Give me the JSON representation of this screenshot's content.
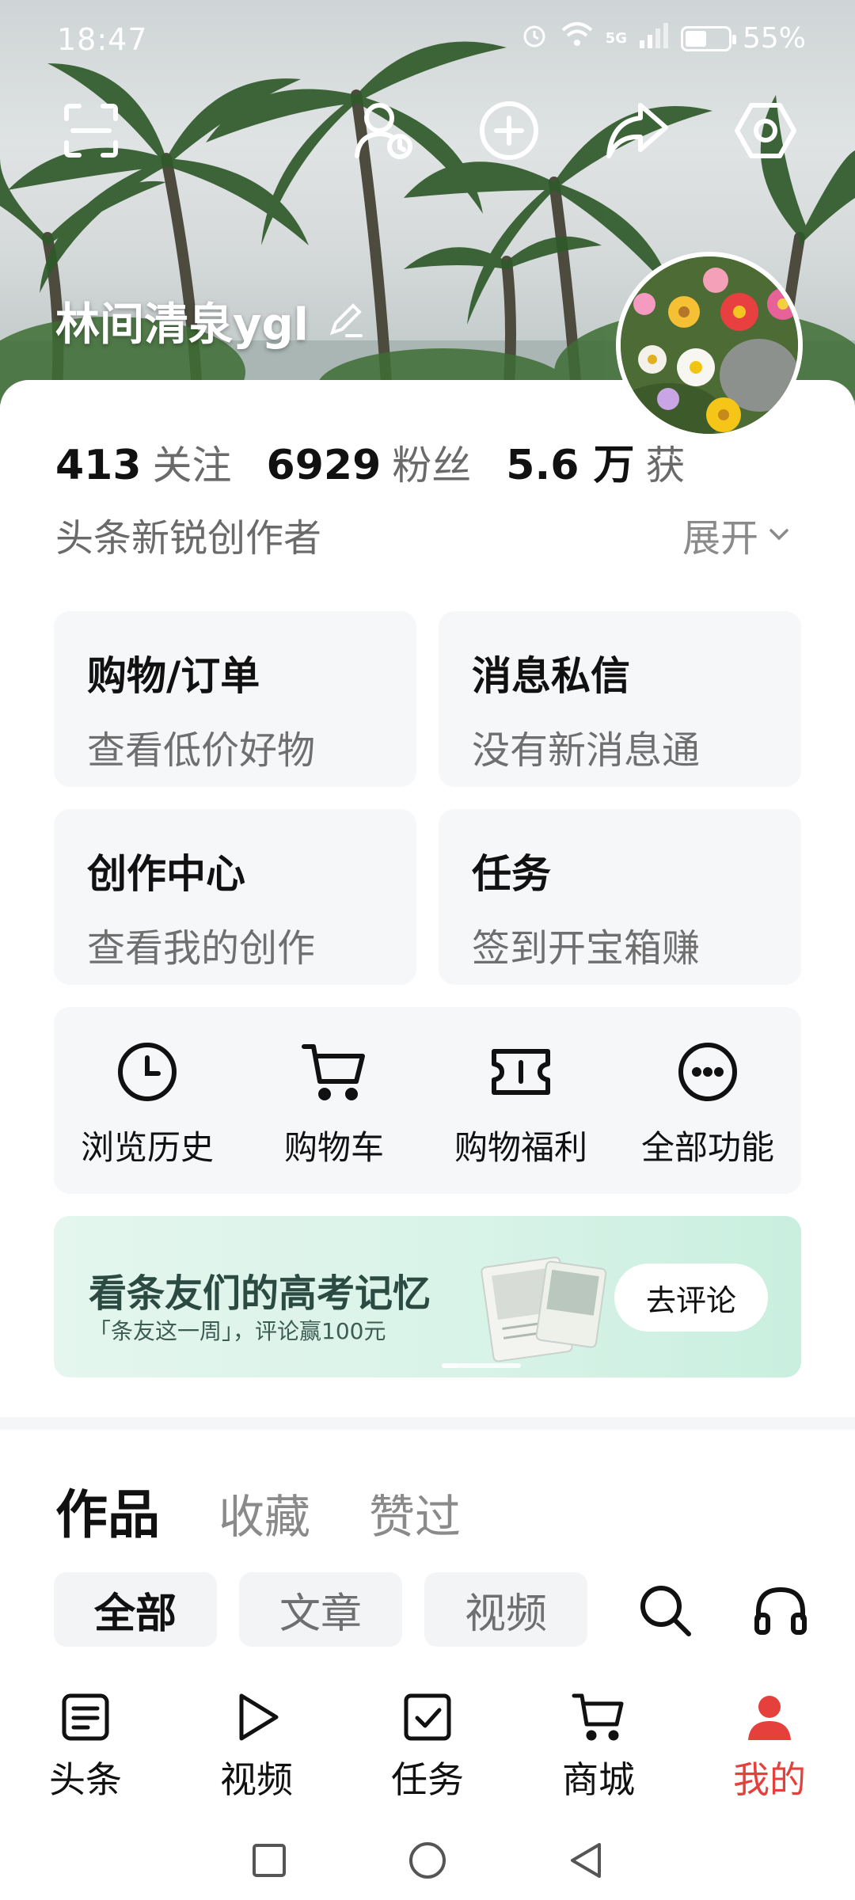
{
  "status_bar": {
    "time": "18:47",
    "network": "5G",
    "battery_percent": "55%",
    "battery_level": 0.55
  },
  "header": {
    "username": "林间清泉ygl",
    "icons": [
      "scan-icon",
      "user-clock-icon",
      "add-circle-icon",
      "share-icon",
      "settings-icon"
    ]
  },
  "stats": [
    {
      "value": "413",
      "label": "关注"
    },
    {
      "value": "6929",
      "label": "粉丝"
    },
    {
      "value": "5.6 万",
      "label": "获"
    }
  ],
  "profile": {
    "creator_tag": "头条新锐创作者",
    "expand_label": "展开"
  },
  "tiles": [
    {
      "title": "购物/订单",
      "subtitle": "查看低价好物"
    },
    {
      "title": "消息私信",
      "subtitle": "没有新消息通"
    },
    {
      "title": "创作中心",
      "subtitle": "查看我的创作"
    },
    {
      "title": "任务",
      "subtitle": "签到开宝箱赚"
    }
  ],
  "shortcuts": [
    {
      "label": "浏览历史",
      "icon": "clock-icon"
    },
    {
      "label": "购物车",
      "icon": "cart-icon"
    },
    {
      "label": "购物福利",
      "icon": "ticket-icon"
    },
    {
      "label": "全部功能",
      "icon": "more-icon"
    }
  ],
  "banner": {
    "title": "看条友们的高考记忆",
    "subtitle": "「条友这一周」，评论赢100元",
    "button": "去评论"
  },
  "content_tabs": [
    {
      "label": "作品",
      "active": true
    },
    {
      "label": "收藏",
      "active": false
    },
    {
      "label": "赞过",
      "active": false
    }
  ],
  "filters": [
    {
      "label": "全部",
      "active": true
    },
    {
      "label": "文章",
      "active": false
    },
    {
      "label": "视频",
      "active": false
    }
  ],
  "bottom_nav": [
    {
      "label": "头条",
      "icon": "article-icon",
      "active": false
    },
    {
      "label": "视频",
      "icon": "play-icon",
      "active": false
    },
    {
      "label": "任务",
      "icon": "task-check-icon",
      "active": false
    },
    {
      "label": "商城",
      "icon": "mall-cart-icon",
      "active": false
    },
    {
      "label": "我的",
      "icon": "profile-icon",
      "active": true
    }
  ],
  "colors": {
    "accent": "#e5403b",
    "card_bg": "#f6f7f9",
    "text_secondary": "#6f6f6f"
  }
}
